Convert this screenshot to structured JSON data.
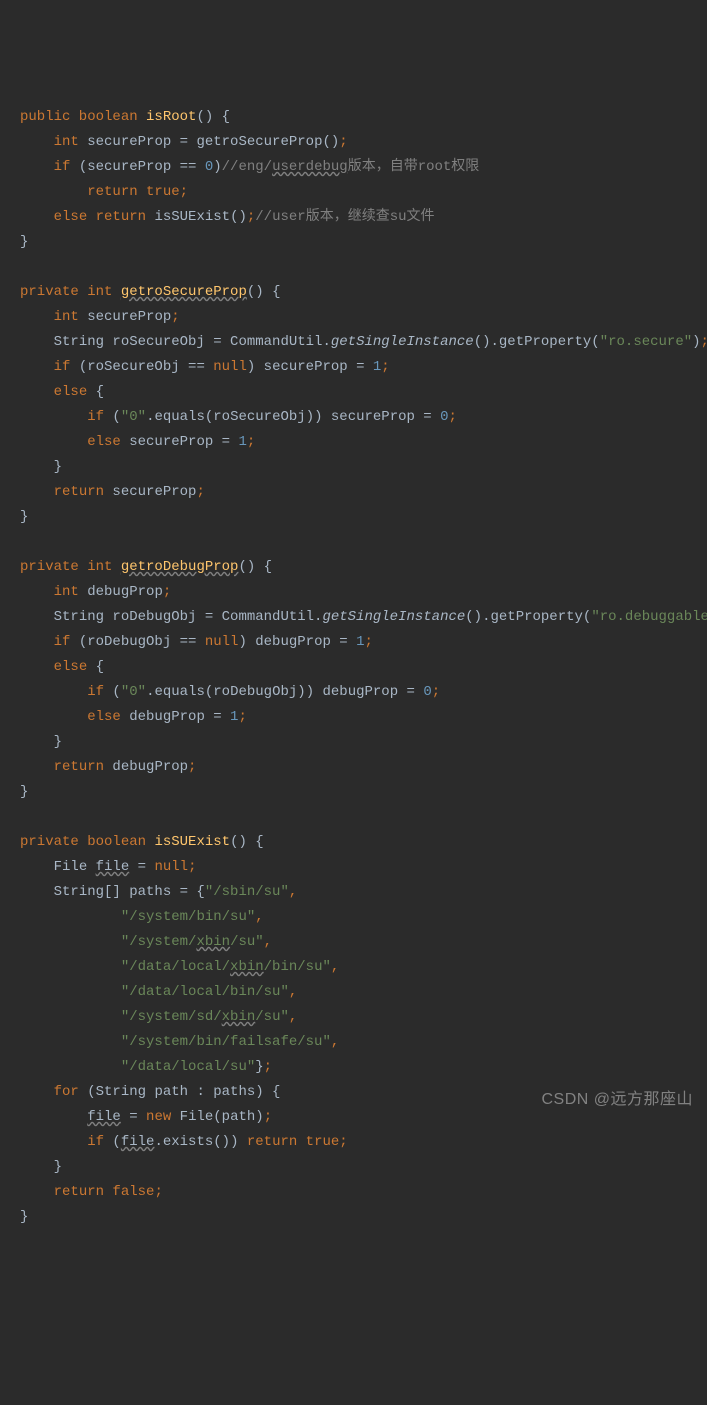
{
  "watermark": "CSDN @远方那座山",
  "code": {
    "isRoot": {
      "sig": {
        "mod": "public boolean",
        "name": "isRoot",
        "parens": "()",
        "brace": " {"
      },
      "l1": {
        "type": "int",
        "rest": " secureProp = getroSecureProp()",
        "semi": ";"
      },
      "l2": {
        "kw": "if",
        "rest": " (secureProp == ",
        "zero": "0",
        "close": ")",
        "cmt_a": "//eng/",
        "cmt_u": "userdebug",
        "cmt_b": "版本，自带root权限"
      },
      "l3": {
        "kw": "return true",
        "semi": ";"
      },
      "l4": {
        "kw1": "else return",
        "sp": " ",
        "call": "isSUExist",
        "rest": "()",
        "semi": ";",
        "cmt": "//user版本，继续查su文件"
      }
    },
    "getroSecureProp": {
      "sig": {
        "mod": "private int",
        "sp": " ",
        "name": "getroSecureProp",
        "parens": "()",
        "brace": " {"
      },
      "l1": {
        "type": "int",
        "rest": " secureProp",
        "semi": ";"
      },
      "l2": {
        "a": "String roSecureObj = CommandUtil.",
        "call": "getSingleInstance",
        "b": "().getProperty(",
        "str": "\"ro.secure\"",
        "c": ")",
        "semi": ";"
      },
      "l3": {
        "kw": "if",
        "a": " (roSecureObj == ",
        "null": "null",
        "b": ") secureProp = ",
        "num": "1",
        "semi": ";"
      },
      "l4": {
        "kw": "else",
        "rest": " {"
      },
      "l5": {
        "kw": "if",
        "a": " (",
        "str": "\"0\"",
        "b": ".equals(roSecureObj)) secureProp = ",
        "num": "0",
        "semi": ";"
      },
      "l6": {
        "kw": "else",
        "a": " secureProp = ",
        "num": "1",
        "semi": ";"
      },
      "l7": {
        "a": "}"
      },
      "l8": {
        "kw": "return",
        "a": " secureProp",
        "semi": ";"
      }
    },
    "getroDebugProp": {
      "sig": {
        "mod": "private int",
        "sp": " ",
        "name": "getroDebugProp",
        "parens": "()",
        "brace": " {"
      },
      "l1": {
        "type": "int",
        "rest": " debugProp",
        "semi": ";"
      },
      "l2": {
        "a": "String roDebugObj = CommandUtil.",
        "call": "getSingleInstance",
        "b": "().getProperty(",
        "str": "\"ro.debuggable\"",
        "c": ")",
        "semi": ";"
      },
      "l3": {
        "kw": "if",
        "a": " (roDebugObj == ",
        "null": "null",
        "b": ") debugProp = ",
        "num": "1",
        "semi": ";"
      },
      "l4": {
        "kw": "else",
        "rest": " {"
      },
      "l5": {
        "kw": "if",
        "a": " (",
        "str": "\"0\"",
        "b": ".equals(roDebugObj)) debugProp = ",
        "num": "0",
        "semi": ";"
      },
      "l6": {
        "kw": "else",
        "a": " debugProp = ",
        "num": "1",
        "semi": ";"
      },
      "l7": {
        "a": "}"
      },
      "l8": {
        "kw": "return",
        "a": " debugProp",
        "semi": ";"
      }
    },
    "isSUExist": {
      "sig": {
        "mod": "private boolean",
        "sp": " ",
        "name": "isSUExist",
        "parens": "()",
        "brace": " {"
      },
      "l1": {
        "a": "File ",
        "file": "file",
        "b": " = ",
        "null": "null",
        "semi": ";"
      },
      "l2": {
        "a": "String[] paths = {",
        "str": "\"/sbin/su\"",
        "c": ","
      },
      "p1": {
        "str": "\"/system/bin/su\"",
        "c": ","
      },
      "p2": {
        "a": "\"/system/",
        "xbin": "xbin",
        "b": "/su\"",
        "c": ","
      },
      "p3": {
        "a": "\"/data/local/",
        "xbin": "xbin",
        "b": "/bin/su\"",
        "c": ","
      },
      "p4": {
        "str": "\"/data/local/bin/su\"",
        "c": ","
      },
      "p5": {
        "a": "\"/system/sd/",
        "xbin": "xbin",
        "b": "/su\"",
        "c": ","
      },
      "p6": {
        "str": "\"/system/bin/failsafe/su\"",
        "c": ","
      },
      "p7": {
        "str": "\"/data/local/su\"",
        "c": "}",
        "semi": ";"
      },
      "for": {
        "kw": "for",
        "a": " (String path : paths) {"
      },
      "f1": {
        "file": "file",
        "a": " = ",
        "new": "new",
        "b": " File(path)",
        "semi": ";"
      },
      "f2": {
        "kw": "if",
        "a": " (",
        "file": "file",
        "b": ".exists()) ",
        "ret": "return true",
        "semi": ";"
      },
      "f3": {
        "a": "}"
      },
      "ret": {
        "kw": "return false",
        "semi": ";"
      }
    }
  }
}
